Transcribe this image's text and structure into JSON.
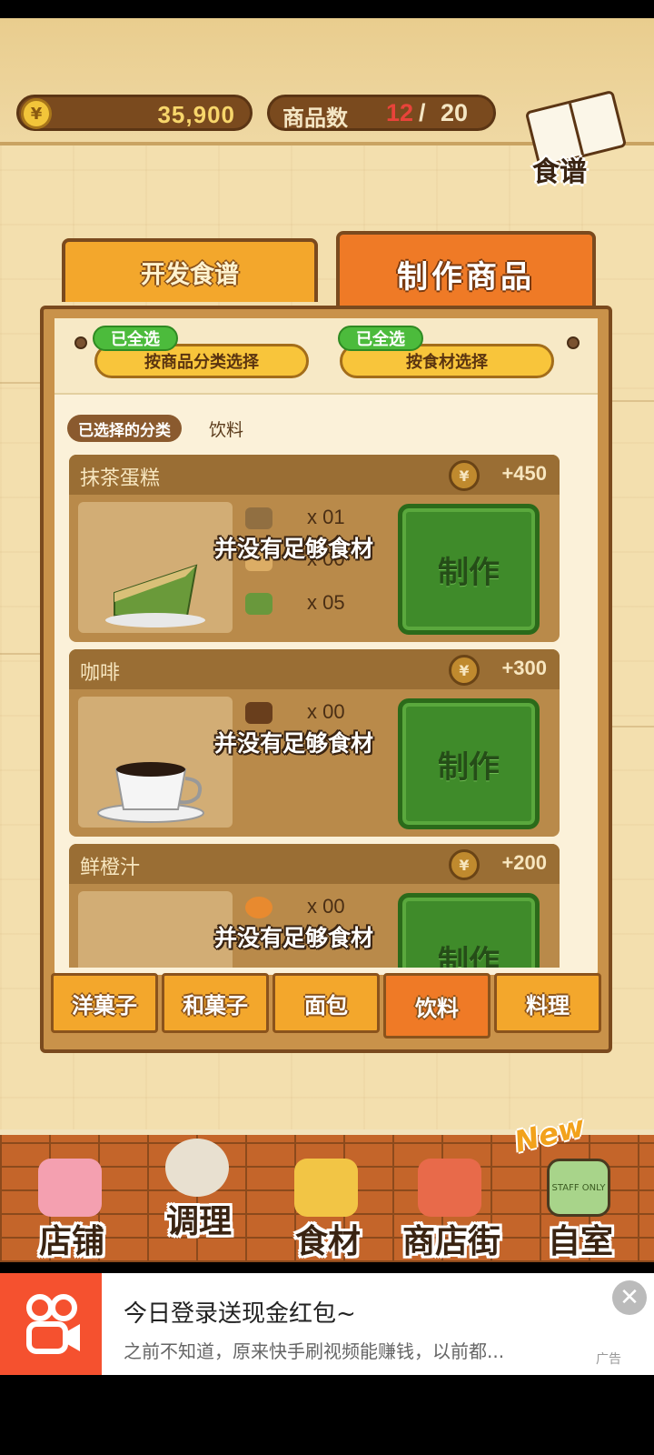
{
  "header": {
    "coin_symbol": "¥",
    "coins": "35,900",
    "product_count_label": "商品数",
    "product_count_current": "12",
    "product_count_sep": "/",
    "product_count_max": "20",
    "recipe_book_label": "食谱"
  },
  "tabs": {
    "develop": "开发食谱",
    "make": "制作商品"
  },
  "filters": {
    "by_category": {
      "badge": "已全选",
      "label": "按商品分类选择"
    },
    "by_ingredient": {
      "badge": "已全选",
      "label": "按食材选择"
    }
  },
  "selected_category": {
    "tag": "已选择的分类",
    "value": "饮料"
  },
  "products": [
    {
      "name": "抹茶蛋糕",
      "price": "+450",
      "ingredients": [
        {
          "qty": "x 01",
          "icon": "flour-bag-icon"
        },
        {
          "qty": "x 00",
          "icon": "egg-icon"
        },
        {
          "qty": "x 05",
          "icon": "matcha-icon"
        }
      ],
      "warning": "并没有足够食材",
      "button": "制作"
    },
    {
      "name": "咖啡",
      "price": "+300",
      "ingredients": [
        {
          "qty": "x 00",
          "icon": "coffee-beans-icon"
        }
      ],
      "warning": "并没有足够食材",
      "button": "制作"
    },
    {
      "name": "鲜橙汁",
      "price": "+200",
      "ingredients": [
        {
          "qty": "x 00",
          "icon": "orange-icon"
        }
      ],
      "warning": "并没有足够食材",
      "button": "制作"
    }
  ],
  "category_tabs": [
    "洋菓子",
    "和菓子",
    "面包",
    "饮料",
    "料理"
  ],
  "active_category_tab": "饮料",
  "bottom_nav": {
    "items": [
      "店铺",
      "调理",
      "食材",
      "商店街",
      "自室"
    ],
    "new_badge": "New",
    "staff_sign": "STAFF ONLY"
  },
  "ad": {
    "title": "今日登录送现金红包~",
    "description": "之前不知道，原来快手刷视频能赚钱，以前都...",
    "close": "✕",
    "tag": "广告"
  },
  "colors": {
    "accent_orange": "#ef7a26",
    "tab_yellow": "#f3a72c",
    "make_green": "#3f8b2a",
    "warning_text": "#ffffff",
    "count_red": "#e8433a"
  }
}
